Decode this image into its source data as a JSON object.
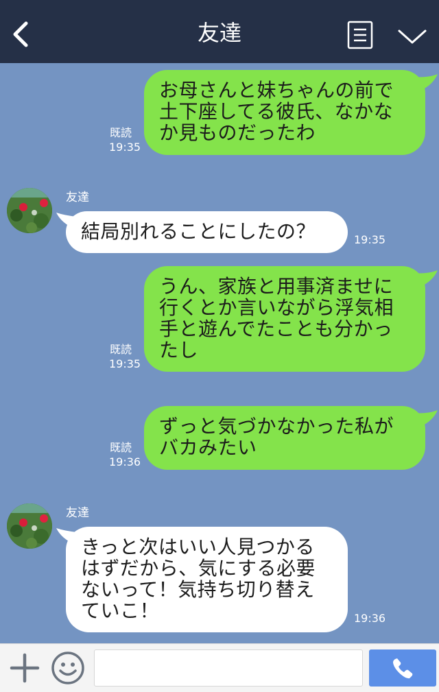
{
  "header": {
    "title": "友達",
    "icons": {
      "back": "chevron-left-icon",
      "menu": "list-menu-icon",
      "collapse": "chevron-down-icon"
    }
  },
  "colors": {
    "header_bg": "#253047",
    "chat_bg": "#7494c2",
    "my_bubble": "#84e34b",
    "friend_bubble": "#ffffff",
    "call_button": "#5c8fe7"
  },
  "messages": [
    {
      "from": "me",
      "text": "お母さんと妹ちゃんの前で\n土下座してる彼氏、なかな\nか見ものだったわ",
      "read": "既読",
      "time": "19:35"
    },
    {
      "from": "friend",
      "sender": "友達",
      "text": "結局別れることにしたの？",
      "time": "19:35"
    },
    {
      "from": "me",
      "text": "うん、家族と用事済ませに\n行くとか言いながら浮気相\n手と遊んでたことも分かっ\nたし",
      "read": "既読",
      "time": "19:35"
    },
    {
      "from": "me",
      "text": "ずっと気づかなかった私が\nバカみたい",
      "read": "既読",
      "time": "19:36"
    },
    {
      "from": "friend",
      "sender": "友達",
      "text": "きっと次はいい人見つかる\nはずだから、気にする必要\nないって！気持ち切り替え\nていこ！",
      "time": "19:36"
    }
  ],
  "footer": {
    "input_value": "",
    "icons": {
      "plus": "plus-icon",
      "emoji": "smiley-icon",
      "call": "phone-icon"
    }
  }
}
